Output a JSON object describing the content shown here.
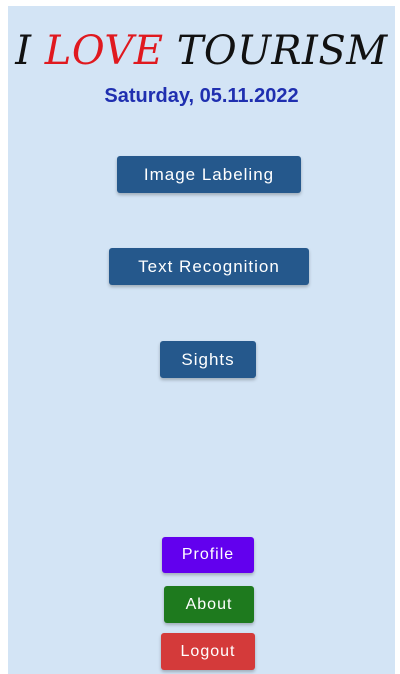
{
  "header": {
    "title_prefix": "I ",
    "title_accent": "LOVE",
    "title_suffix": " TOURISM",
    "date": "Saturday, 05.11.2022"
  },
  "actions": {
    "image_labeling": "Image Labeling",
    "text_recognition": "Text Recognition",
    "sights": "Sights"
  },
  "footer": {
    "profile": "Profile",
    "about": "About",
    "logout": "Logout"
  },
  "colors": {
    "background": "#d3e4f5",
    "title": "#111111",
    "title_accent": "#e0191f",
    "date": "#1f2fb0",
    "main_button": "#25588c",
    "profile_button": "#6200ee",
    "about_button": "#1e7a1e",
    "logout_button": "#d43a3a"
  }
}
